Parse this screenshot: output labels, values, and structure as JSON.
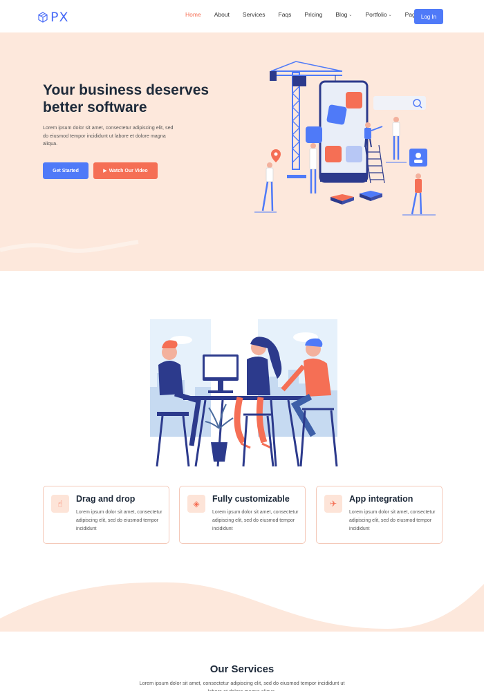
{
  "brand": {
    "name": "PX"
  },
  "nav": {
    "items": [
      {
        "label": "Home",
        "active": true,
        "dropdown": false
      },
      {
        "label": "About",
        "active": false,
        "dropdown": false
      },
      {
        "label": "Services",
        "active": false,
        "dropdown": false
      },
      {
        "label": "Faqs",
        "active": false,
        "dropdown": false
      },
      {
        "label": "Pricing",
        "active": false,
        "dropdown": false
      },
      {
        "label": "Blog",
        "active": false,
        "dropdown": true
      },
      {
        "label": "Portfolio",
        "active": false,
        "dropdown": true
      },
      {
        "label": "Pages",
        "active": false,
        "dropdown": true
      }
    ],
    "login_label": "Log In"
  },
  "hero": {
    "title": "Your business deserves better software",
    "text": "Lorem ipsum dolor sit amet, consectetur adipiscing elit, sed do eiusmod tempor incididunt ut labore et dolore magna aliqua.",
    "primary_button": "Get Started",
    "secondary_button": "Watch Our Video",
    "secondary_icon": "play-icon"
  },
  "features": [
    {
      "icon": "pointer-hand-icon",
      "title": "Drag and drop",
      "text": "Lorem ipsum dolor sit amet, consectetur adipiscing elit, sed do eiusmod tempor incididunt"
    },
    {
      "icon": "diamond-icon",
      "title": "Fully customizable",
      "text": "Lorem ipsum dolor sit amet, consectetur adipiscing elit, sed do eiusmod tempor incididunt"
    },
    {
      "icon": "rocket-icon",
      "title": "App integration",
      "text": "Lorem ipsum dolor sit amet, consectetur adipiscing elit, sed do eiusmod tempor incididunt"
    }
  ],
  "services": {
    "title": "Our Services",
    "text": "Lorem ipsum dolor sit amet, consectetur adipiscing elit, sed do eiusmod tempor incididunt ut labore et dolore magna aliqua."
  },
  "colors": {
    "accent": "#4f7af8",
    "secondary": "#f56f55",
    "hero_bg": "#fde8dc",
    "dark": "#1e2a3a"
  }
}
